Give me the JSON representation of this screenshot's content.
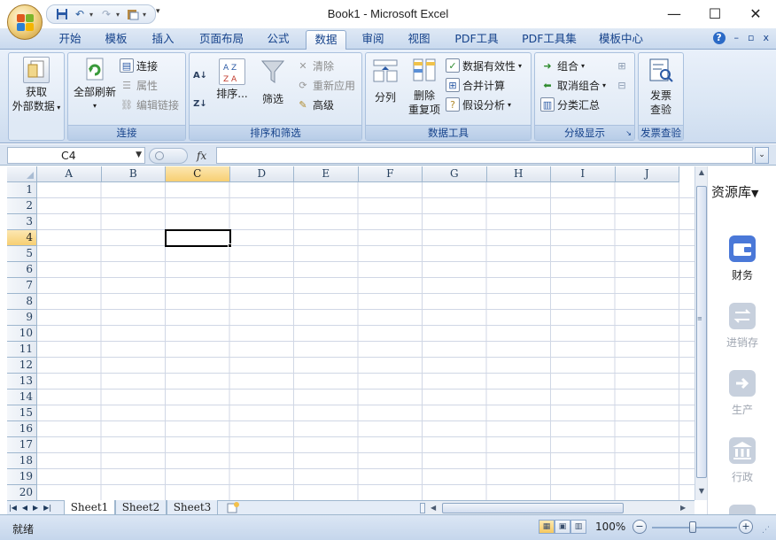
{
  "window": {
    "title": "Book1 - Microsoft Excel",
    "minimize": "—",
    "maximize": "☐",
    "close": "✕"
  },
  "qat": {
    "save_icon": "save-icon",
    "undo_icon": "undo-icon",
    "redo_icon": "redo-icon",
    "paste_icon": "paste-icon"
  },
  "ribbon_tabs": [
    "开始",
    "模板",
    "插入",
    "页面布局",
    "公式",
    "数据",
    "审阅",
    "视图",
    "PDF工具",
    "PDF工具集",
    "模板中心"
  ],
  "active_tab": "数据",
  "ribbon_right": {
    "help": "?",
    "min": "–",
    "restore": "▫",
    "close": "x"
  },
  "groups": {
    "get_external": {
      "label1": "获取",
      "label2": "外部数据"
    },
    "connections": {
      "refresh_all": "全部刷新",
      "connections": "连接",
      "properties": "属性",
      "edit_links": "编辑链接",
      "title": "连接"
    },
    "sort_filter": {
      "sort": "排序...",
      "filter": "筛选",
      "clear": "清除",
      "reapply": "重新应用",
      "advanced": "高级",
      "title": "排序和筛选"
    },
    "data_tools": {
      "text_to_columns": "分列",
      "remove_dup1": "删除",
      "remove_dup2": "重复项",
      "validation": "数据有效性",
      "consolidate": "合并计算",
      "what_if": "假设分析",
      "title": "数据工具"
    },
    "outline": {
      "group": "组合",
      "ungroup": "取消组合",
      "subtotal": "分类汇总",
      "title": "分级显示"
    },
    "invoice": {
      "check1": "发票",
      "check2": "查验",
      "title": "发票查验"
    }
  },
  "formula_bar": {
    "name_box": "C4",
    "fx": "fx",
    "value": ""
  },
  "columns": [
    "A",
    "B",
    "C",
    "D",
    "E",
    "F",
    "G",
    "H",
    "I",
    "J"
  ],
  "rows": [
    "1",
    "2",
    "3",
    "4",
    "5",
    "6",
    "7",
    "8",
    "9",
    "10",
    "11",
    "12",
    "13",
    "14",
    "15",
    "16",
    "17",
    "18",
    "19",
    "20"
  ],
  "selected_cell": {
    "column": "C",
    "row": "4"
  },
  "sheets": [
    "Sheet1",
    "Sheet2",
    "Sheet3"
  ],
  "active_sheet": "Sheet1",
  "status": {
    "ready": "就绪",
    "zoom": "100%"
  },
  "side_panel": {
    "title": "资源库",
    "items": [
      {
        "label": "财务",
        "icon": "wallet-icon",
        "active": true
      },
      {
        "label": "进销存",
        "icon": "exchange-icon",
        "active": false
      },
      {
        "label": "生产",
        "icon": "arrow-right-icon",
        "active": false
      },
      {
        "label": "行政",
        "icon": "bank-icon",
        "active": false
      }
    ]
  },
  "colors": {
    "ribbon_blue": "#15428b",
    "selection_orange": "#f7cf72",
    "side_active": "#4a78d8",
    "side_inactive": "#c7d0dd"
  }
}
